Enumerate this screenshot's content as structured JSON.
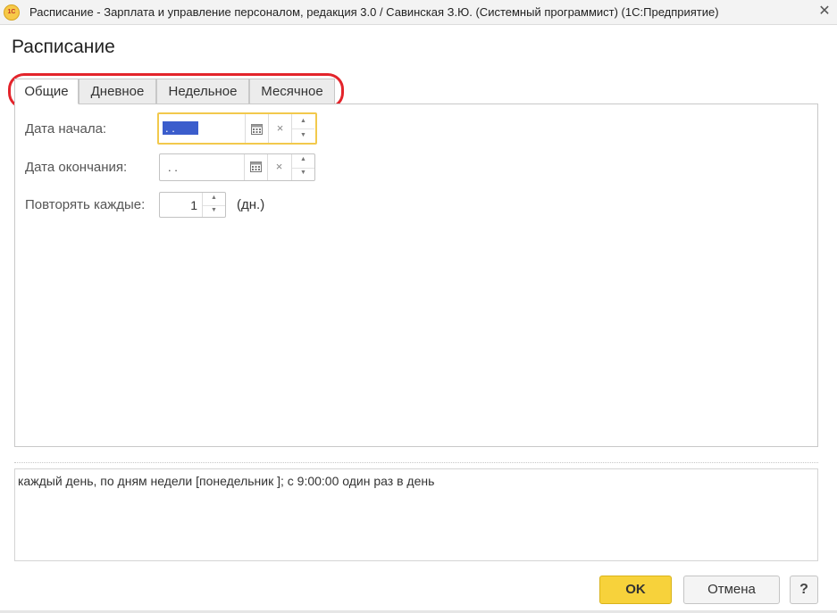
{
  "window": {
    "app_icon_text": "1C",
    "title": "Расписание - Зарплата и управление персоналом, редакция 3.0 / Савинская З.Ю. (Системный программист)  (1С:Предприятие)",
    "close_glyph": "✕"
  },
  "page_title": "Расписание",
  "tabs": [
    {
      "label": "Общие",
      "active": true
    },
    {
      "label": "Дневное",
      "active": false
    },
    {
      "label": "Недельное",
      "active": false
    },
    {
      "label": "Месячное",
      "active": false
    }
  ],
  "form": {
    "start_date": {
      "label": "Дата начала:",
      "value": " .  ."
    },
    "end_date": {
      "label": "Дата окончания:",
      "value": " .  ."
    },
    "repeat": {
      "label": "Повторять каждые:",
      "value": "1",
      "unit": "(дн.)"
    }
  },
  "glyphs": {
    "clear": "×",
    "spin_up": "▲",
    "spin_down": "▼"
  },
  "description": "каждый  день, по дням недели [понедельник ]; с 9:00:00 один раз в день",
  "buttons": {
    "ok": "OK",
    "cancel": "Отмена",
    "help": "?"
  },
  "colors": {
    "accent": "#f7d23b",
    "annotation": "#e3242b",
    "selection": "#3b5dcc"
  },
  "icons": [
    "app-logo-icon",
    "close-icon",
    "calendar-icon",
    "clear-icon",
    "spin-up-icon",
    "spin-down-icon"
  ]
}
